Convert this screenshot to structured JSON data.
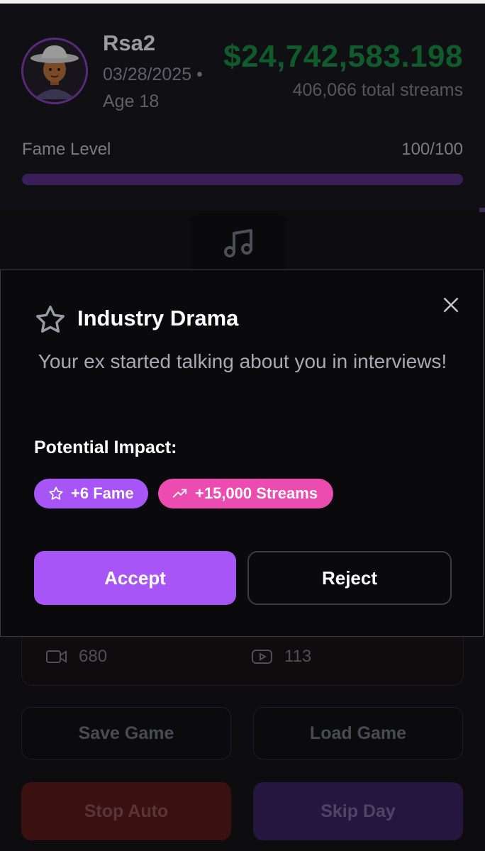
{
  "profile": {
    "username": "Rsa2",
    "date": "03/28/2025 •",
    "age": "Age 18",
    "money": "$24,742,583.198",
    "total_streams": "406,066 total streams"
  },
  "fame": {
    "label": "Fame Level",
    "value_text": "100/100",
    "progress": 1.0
  },
  "stats": {
    "videos": "680",
    "youtube": "113"
  },
  "game_buttons": {
    "save": "Save Game",
    "load": "Load Game",
    "stop_auto": "Stop Auto",
    "skip_day": "Skip Day"
  },
  "modal": {
    "title": "Industry Drama",
    "description": "Your ex started talking about you in interviews!",
    "impact_label": "Potential Impact:",
    "badges": [
      {
        "text": "+6 Fame",
        "icon": "star-icon",
        "color": "#a855f7"
      },
      {
        "text": "+15,000 Streams",
        "icon": "trending-up-icon",
        "color": "#ec4bb0"
      }
    ],
    "accept_label": "Accept",
    "reject_label": "Reject"
  },
  "colors": {
    "accent_purple": "#a855f7",
    "accent_pink": "#ec4bb0",
    "money_green": "#0f5b2c"
  }
}
